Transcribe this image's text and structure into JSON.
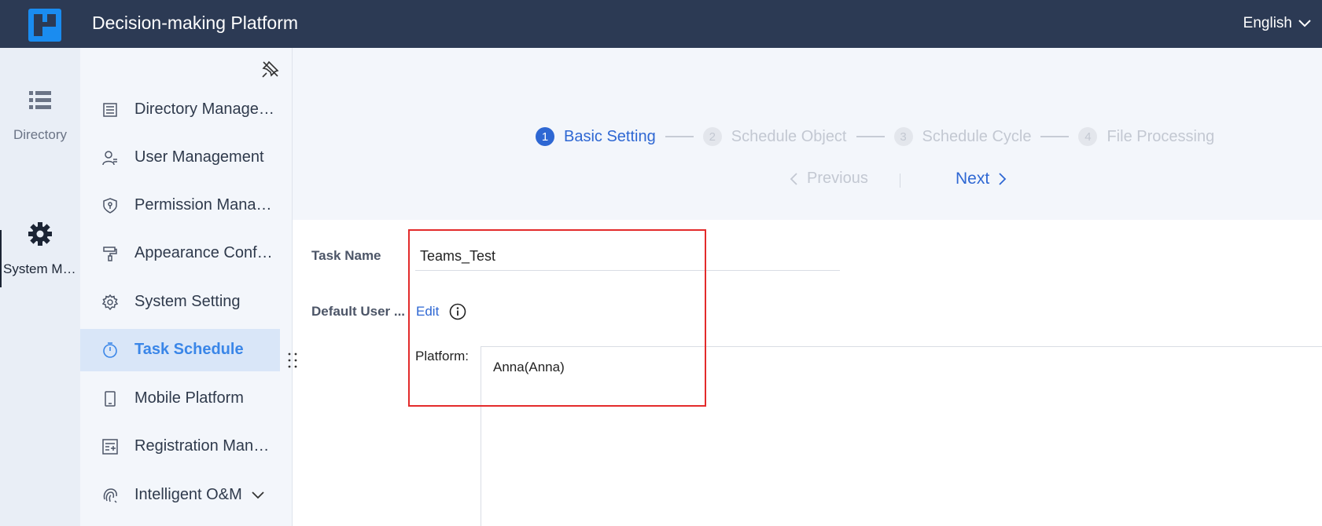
{
  "header": {
    "title": "Decision-making Platform",
    "language": "English"
  },
  "rail": {
    "items": [
      {
        "label": "Directory",
        "icon": "list-icon"
      },
      {
        "label": "System Management",
        "icon": "gear-icon"
      }
    ]
  },
  "sidebar": {
    "items": [
      {
        "label": "Directory Management",
        "icon": "directory-icon"
      },
      {
        "label": "User Management",
        "icon": "user-icon"
      },
      {
        "label": "Permission Management",
        "icon": "shield-icon"
      },
      {
        "label": "Appearance Configuration",
        "icon": "paint-roller-icon"
      },
      {
        "label": "System Setting",
        "icon": "gear-icon"
      },
      {
        "label": "Task Schedule",
        "icon": "stopwatch-icon",
        "active": true
      },
      {
        "label": "Mobile Platform",
        "icon": "mobile-icon"
      },
      {
        "label": "Registration Management",
        "icon": "registration-icon"
      },
      {
        "label": "Intelligent O&M",
        "icon": "fingerprint-icon"
      }
    ]
  },
  "steps": [
    {
      "num": "1",
      "label": "Basic Setting",
      "active": true
    },
    {
      "num": "2",
      "label": "Schedule Object",
      "active": false
    },
    {
      "num": "3",
      "label": "Schedule Cycle",
      "active": false
    },
    {
      "num": "4",
      "label": "File Processing",
      "active": false
    }
  ],
  "nav": {
    "previous": "Previous",
    "next": "Next"
  },
  "form": {
    "task_name_label": "Task Name",
    "task_name_value": "Teams_Test",
    "default_user_label": "Default User ...",
    "edit_label": "Edit",
    "platform_label": "Platform:",
    "platform_user": "Anna(Anna)"
  },
  "colors": {
    "header_bg": "#2c3a54",
    "accent": "#2e67d3",
    "active_menu_text": "#3a86e8",
    "highlight_box": "#e32b2b"
  }
}
